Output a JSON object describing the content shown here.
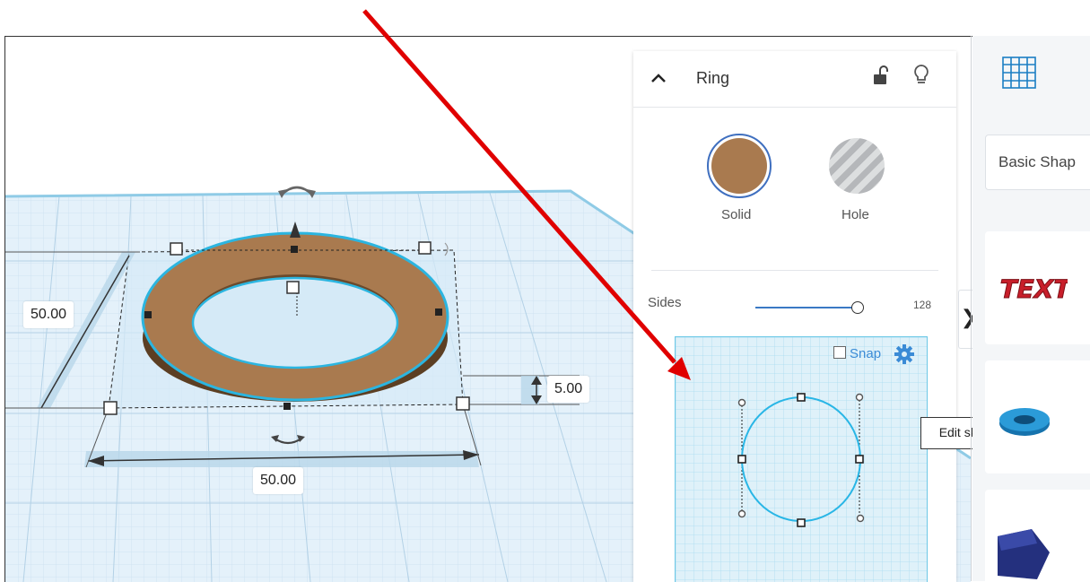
{
  "inspector": {
    "shape_name": "Ring",
    "solid_label": "Solid",
    "hole_label": "Hole",
    "sides_label": "Sides",
    "sides_value": "128",
    "sides_fraction": 0.95,
    "snap_label": "Snap",
    "tooltip": "Edit sketch settings",
    "solid_color": "#a97a4f",
    "icons": [
      "chevron-up-icon",
      "lock-open-icon",
      "lightbulb-icon",
      "gear-icon"
    ]
  },
  "workplane": {
    "width_dim": "50.00",
    "length_dim": "50.00",
    "height_dim": "5.00",
    "ring_color": "#a97a4f",
    "selection_color": "#2bb5e0"
  },
  "shapes_panel": {
    "category_label": "Basic Shap",
    "tile_icons": [
      "grid-icon",
      "text-shape-icon",
      "torus-shape-icon",
      "polygon-shape-icon"
    ]
  },
  "annotation": {
    "arrow_color": "#e00000"
  }
}
